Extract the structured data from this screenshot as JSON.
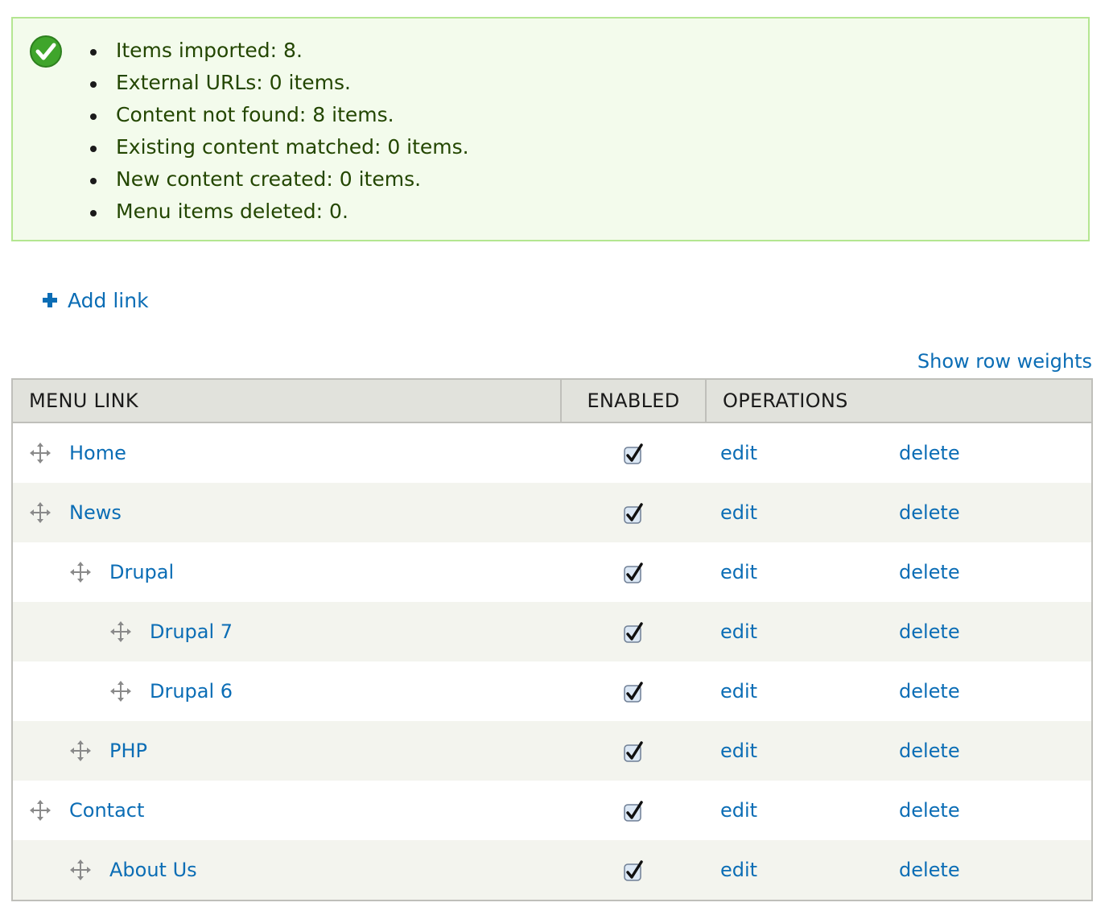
{
  "messages": {
    "status_icon": "check-circle-icon",
    "items": [
      "Items imported: 8.",
      "External URLs: 0 items.",
      "Content not found: 8 items.",
      "Existing content matched: 0 items.",
      "New content created: 0 items.",
      "Menu items deleted: 0."
    ]
  },
  "actions": {
    "add_link_label": "Add link",
    "add_link_icon": "plus-icon"
  },
  "table": {
    "show_weights_label": "Show row weights",
    "headers": {
      "menu_link": "MENU LINK",
      "enabled": "ENABLED",
      "operations": "OPERATIONS"
    },
    "rows": [
      {
        "title": "Home",
        "depth": 0,
        "enabled": true,
        "edit": "edit",
        "delete": "delete"
      },
      {
        "title": "News",
        "depth": 0,
        "enabled": true,
        "edit": "edit",
        "delete": "delete"
      },
      {
        "title": "Drupal",
        "depth": 1,
        "enabled": true,
        "edit": "edit",
        "delete": "delete"
      },
      {
        "title": "Drupal 7",
        "depth": 2,
        "enabled": true,
        "edit": "edit",
        "delete": "delete"
      },
      {
        "title": "Drupal 6",
        "depth": 2,
        "enabled": true,
        "edit": "edit",
        "delete": "delete"
      },
      {
        "title": "PHP",
        "depth": 1,
        "enabled": true,
        "edit": "edit",
        "delete": "delete"
      },
      {
        "title": "Contact",
        "depth": 0,
        "enabled": true,
        "edit": "edit",
        "delete": "delete"
      },
      {
        "title": "About Us",
        "depth": 1,
        "enabled": true,
        "edit": "edit",
        "delete": "delete"
      }
    ]
  },
  "colors": {
    "link": "#0b6db5",
    "success_bg": "#f3fbec",
    "success_border": "#b4e691",
    "success_text": "#234600"
  }
}
